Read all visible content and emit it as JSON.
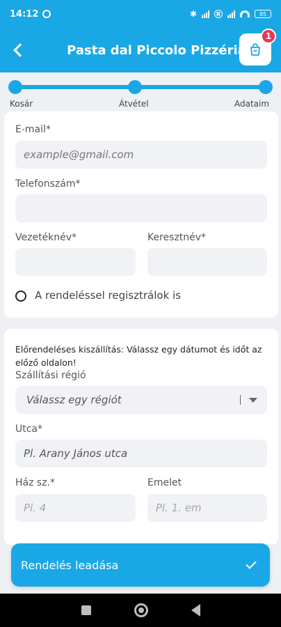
{
  "status_bar": {
    "time": "14:12",
    "battery": "95"
  },
  "header": {
    "title": "Pasta dal Piccolo Pizzéria",
    "cart_count": "1"
  },
  "steps": {
    "items": [
      "Kosár",
      "Átvétel",
      "Adataim"
    ]
  },
  "contact_form": {
    "email_label": "E-mail*",
    "email_placeholder": "example@gmail.com",
    "phone_label": "Telefonszám*",
    "phone_value": "",
    "lastname_label": "Vezetéknév*",
    "lastname_value": "",
    "firstname_label": "Keresztnév*",
    "firstname_value": "",
    "register_label": "A rendeléssel regisztrálok is"
  },
  "delivery_form": {
    "note": "Előrendeléses kiszállítás: Válassz egy dátumot és időt az előző oldalon!",
    "region_label": "Szállítási régió",
    "region_selected": "Válassz egy régiót",
    "street_label": "Utca*",
    "street_value": "Pl. Arany János utca",
    "house_label": "Ház sz.*",
    "house_placeholder": "Pl. 4",
    "floor_label": "Emelet",
    "floor_placeholder": "Pl. 1. em"
  },
  "submit": {
    "label": "Rendelés leadása"
  },
  "colors": {
    "accent": "#1aa7e6",
    "badge": "#e53950"
  }
}
